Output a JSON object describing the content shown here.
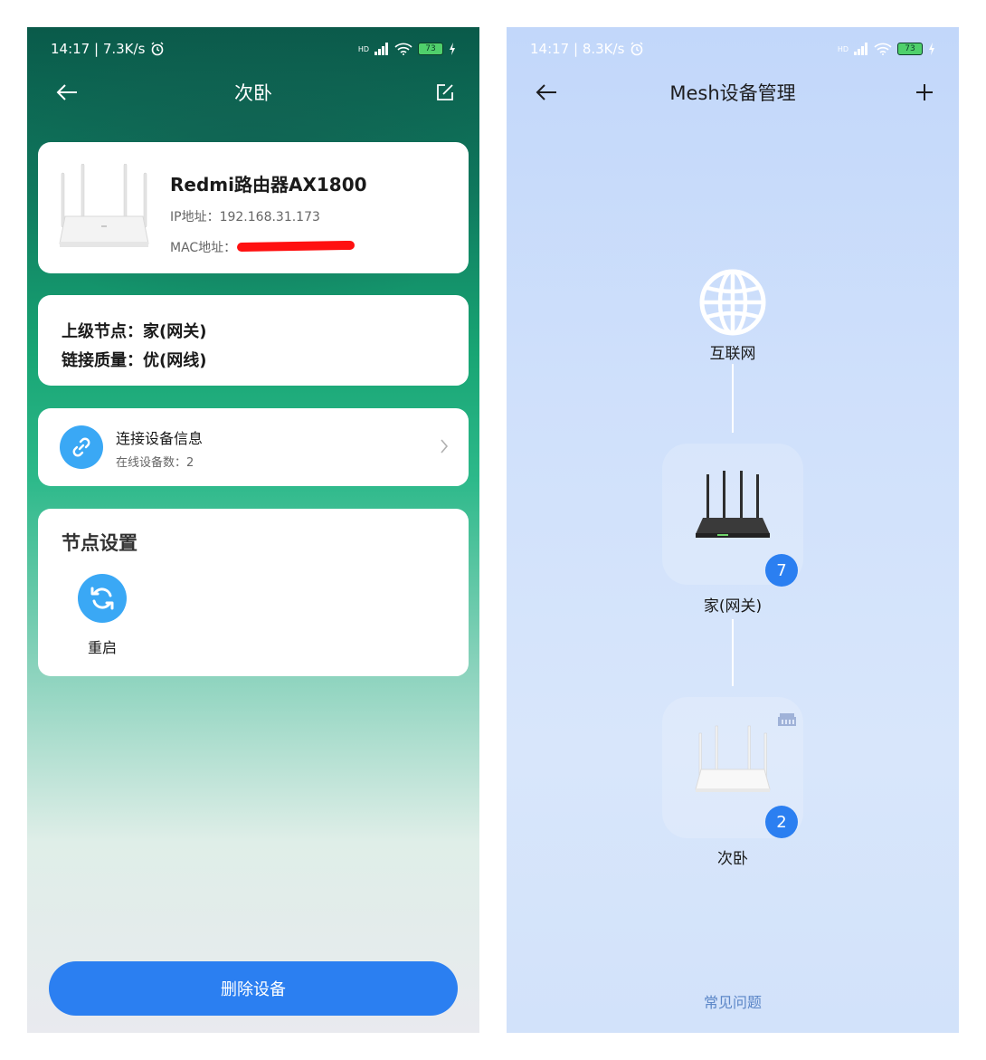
{
  "left_screen": {
    "status_bar": {
      "time_speed": "14:17 | 7.3K/s",
      "hd": "HD",
      "battery": "73"
    },
    "nav": {
      "title": "次卧"
    },
    "device": {
      "name": "Redmi路由器AX1800",
      "ip_label": "IP地址：",
      "ip_value": "192.168.31.173",
      "mac_label": "MAC地址："
    },
    "status": {
      "upper_node": "上级节点：家(网关)",
      "link_quality": "链接质量：优(网线)"
    },
    "connected_devices": {
      "title": "连接设备信息",
      "online": "在线设备数：2"
    },
    "node_settings": {
      "title": "节点设置",
      "restart_label": "重启"
    },
    "delete_button": "删除设备"
  },
  "right_screen": {
    "status_bar": {
      "time_speed": "14:17 | 8.3K/s",
      "hd": "HD",
      "battery": "73"
    },
    "nav": {
      "title": "Mesh设备管理"
    },
    "topology": {
      "internet_label": "互联网",
      "gateway": {
        "label": "家(网关)",
        "devices": "7"
      },
      "bedroom": {
        "label": "次卧",
        "devices": "2"
      }
    },
    "faq": "常见问题"
  },
  "colors": {
    "primary_blue": "#2b7ff1",
    "icon_blue": "#3aa8f5",
    "left_header_green": "#0a5a4a",
    "right_background": "#c2d7fa"
  }
}
